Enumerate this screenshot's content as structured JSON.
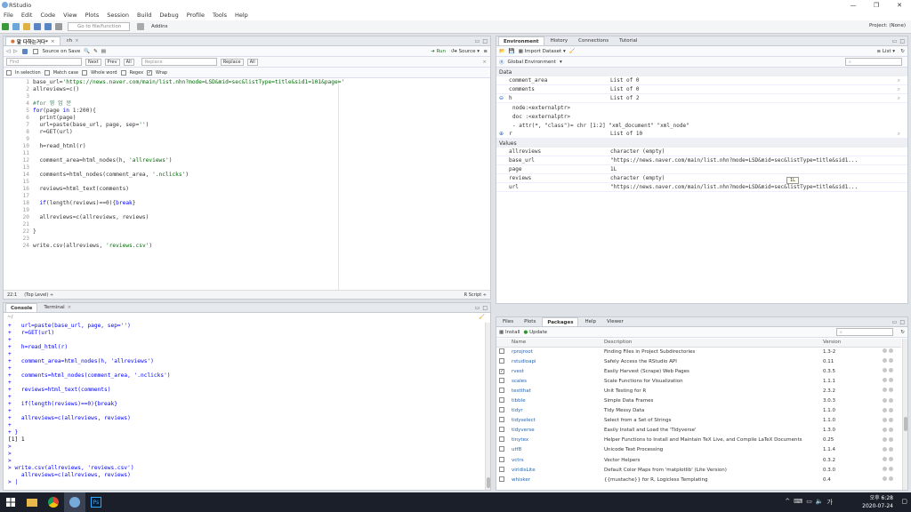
{
  "app": {
    "title": "RStudio",
    "project": "Project: (None)"
  },
  "menu": [
    "File",
    "Edit",
    "Code",
    "View",
    "Plots",
    "Session",
    "Build",
    "Debug",
    "Profile",
    "Tools",
    "Help"
  ],
  "toolbar": {
    "goto_placeholder": "Go to file/function",
    "addins": "Addins"
  },
  "editor": {
    "tabs": [
      "말 다하는거다*",
      "h"
    ],
    "source_on_save": "Source on Save",
    "run": "Run",
    "source": "Source",
    "find_placeholder": "Find",
    "replace_placeholder": "Replace",
    "find_buttons": [
      "Next",
      "Prev",
      "All"
    ],
    "replace_buttons": [
      "Replace",
      "All"
    ],
    "options": [
      "In selection",
      "Match case",
      "Whole word",
      "Regex",
      "Wrap"
    ],
    "line_numbers": [
      "1",
      "2",
      "3",
      "4",
      "5",
      "6",
      "7",
      "8",
      "9",
      "10",
      "11",
      "12",
      "13",
      "14",
      "15",
      "16",
      "17",
      "18",
      "19",
      "20",
      "21",
      "22",
      "23",
      "24"
    ],
    "status_pos": "22:1",
    "status_scope": "(Top Level) ÷",
    "status_type": "R Script ÷"
  },
  "console": {
    "tabs": [
      "Console",
      "Terminal"
    ],
    "path": "~/",
    "lines": [
      "+   url=paste(base_url, page, sep='')",
      "+   r=GET(url)",
      "+",
      "+   h=read_html(r)",
      "+",
      "+   comment_area=html_nodes(h, 'allreviews')",
      "+",
      "+   comments=html_nodes(comment_area, '.nclicks')",
      "+",
      "+   reviews=html_text(comments)",
      "+",
      "+   if(length(reviews)==0){break}",
      "+",
      "+   allreviews=c(allreviews, reviews)",
      "+",
      "+ }",
      "[1] 1",
      ">",
      ">",
      ">",
      "> write.csv(allreviews, 'reviews.csv')",
      "    allreviews=c(allreviews, reviews)",
      "> |"
    ]
  },
  "environment": {
    "tabs": [
      "Environment",
      "History",
      "Connections",
      "Tutorial"
    ],
    "import": "Import Dataset",
    "scope": "Global Environment",
    "view": "List",
    "section_data": "Data",
    "data_rows": [
      {
        "name": "comment_area",
        "value": "List of 0"
      },
      {
        "name": "comments",
        "value": "List of 0"
      },
      {
        "name": "h",
        "value": "List of 2"
      }
    ],
    "h_details": [
      "node:<externalptr>",
      "doc :<externalptr>",
      " - attr(*, \"class\")= chr [1:2] \"xml_document\" \"xml_node\""
    ],
    "r_row": {
      "name": "r",
      "value": "List of 10"
    },
    "section_values": "Values",
    "values": [
      {
        "name": "allreviews",
        "value": "character (empty)"
      },
      {
        "name": "base_url",
        "value": "\"https://news.naver.com/main/list.nhn?mode=LSD&mid=sec&listType=title&sid1..."
      },
      {
        "name": "page",
        "value": "1L"
      },
      {
        "name": "reviews",
        "value": "character (empty)"
      },
      {
        "name": "url",
        "value": "\"https://news.naver.com/main/list.nhn?mode=LSD&mid=sec&listType=title&sid1..."
      }
    ],
    "tooltip": "1L"
  },
  "packages": {
    "tabs": [
      "Files",
      "Plots",
      "Packages",
      "Help",
      "Viewer"
    ],
    "install": "Install",
    "update": "Update",
    "columns": [
      "Name",
      "Description",
      "Version"
    ],
    "rows": [
      {
        "name": "rprojroot",
        "desc": "Finding Files in Project Subdirectories",
        "ver": "1.3-2",
        "checked": false
      },
      {
        "name": "rstudioapi",
        "desc": "Safely Access the RStudio API",
        "ver": "0.11",
        "checked": false
      },
      {
        "name": "rvest",
        "desc": "Easily Harvest (Scrape) Web Pages",
        "ver": "0.3.5",
        "checked": true
      },
      {
        "name": "scales",
        "desc": "Scale Functions for Visualization",
        "ver": "1.1.1",
        "checked": false
      },
      {
        "name": "testthat",
        "desc": "Unit Testing for R",
        "ver": "2.3.2",
        "checked": false
      },
      {
        "name": "tibble",
        "desc": "Simple Data Frames",
        "ver": "3.0.3",
        "checked": false
      },
      {
        "name": "tidyr",
        "desc": "Tidy Messy Data",
        "ver": "1.1.0",
        "checked": false
      },
      {
        "name": "tidyselect",
        "desc": "Select from a Set of Strings",
        "ver": "1.1.0",
        "checked": false
      },
      {
        "name": "tidyverse",
        "desc": "Easily Install and Load the 'Tidyverse'",
        "ver": "1.3.0",
        "checked": false
      },
      {
        "name": "tinytex",
        "desc": "Helper Functions to Install and Maintain TeX Live, and Compile LaTeX Documents",
        "ver": "0.25",
        "checked": false
      },
      {
        "name": "utf8",
        "desc": "Unicode Text Processing",
        "ver": "1.1.4",
        "checked": false
      },
      {
        "name": "vctrs",
        "desc": "Vector Helpers",
        "ver": "0.3.2",
        "checked": false
      },
      {
        "name": "viridisLite",
        "desc": "Default Color Maps from 'matplotlib' (Lite Version)",
        "ver": "0.3.0",
        "checked": false
      },
      {
        "name": "whisker",
        "desc": "{{mustache}} for R, Logicless Templating",
        "ver": "0.4",
        "checked": false
      }
    ]
  },
  "taskbar": {
    "time": "오후 6:28",
    "date": "2020-07-24",
    "ime": "가"
  }
}
